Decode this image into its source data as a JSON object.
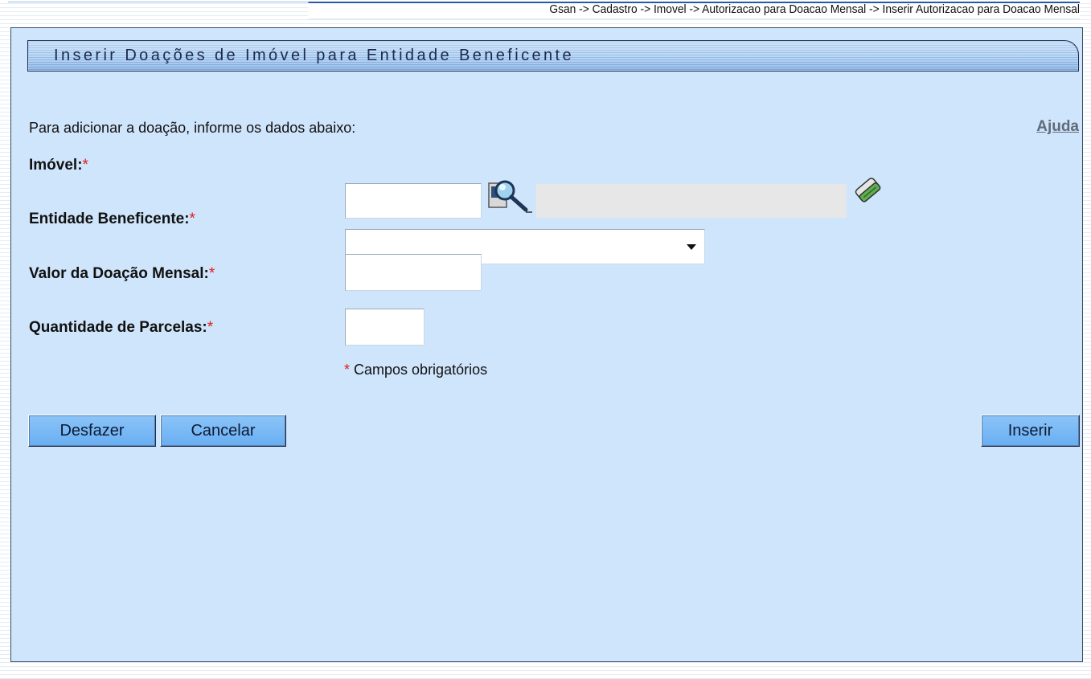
{
  "breadcrumb": {
    "path": "Gsan -> Cadastro -> Imovel -> Autorizacao para Doacao Mensal -> Inserir Autorizacao para Doacao Mensal"
  },
  "panel": {
    "title": "Inserir Doações de Imóvel para Entidade Beneficente",
    "instructions": "Para adicionar a doação, informe os dados abaixo:",
    "help_link": "Ajuda"
  },
  "form": {
    "imovel": {
      "label": "Imóvel:",
      "required_mark": "*",
      "value": "",
      "description_value": "",
      "search_icon": "magnifier-search-icon",
      "clear_icon": "eraser-icon"
    },
    "entidade": {
      "label": "Entidade Beneficente:",
      "required_mark": "*",
      "selected": ""
    },
    "valor": {
      "label": "Valor da Doação Mensal:",
      "required_mark": "*",
      "value": ""
    },
    "parcelas": {
      "label": "Quantidade de Parcelas:",
      "required_mark": "*",
      "value": ""
    },
    "required_note_mark": "*",
    "required_note": " Campos obrigatórios"
  },
  "buttons": {
    "desfazer": "Desfazer",
    "cancelar": "Cancelar",
    "inserir": "Inserir"
  },
  "colors": {
    "panel_bg": "#cfe5fb",
    "button_bg": "#7ab8f5",
    "required": "#e21b1b",
    "help_link": "#606b7a"
  }
}
